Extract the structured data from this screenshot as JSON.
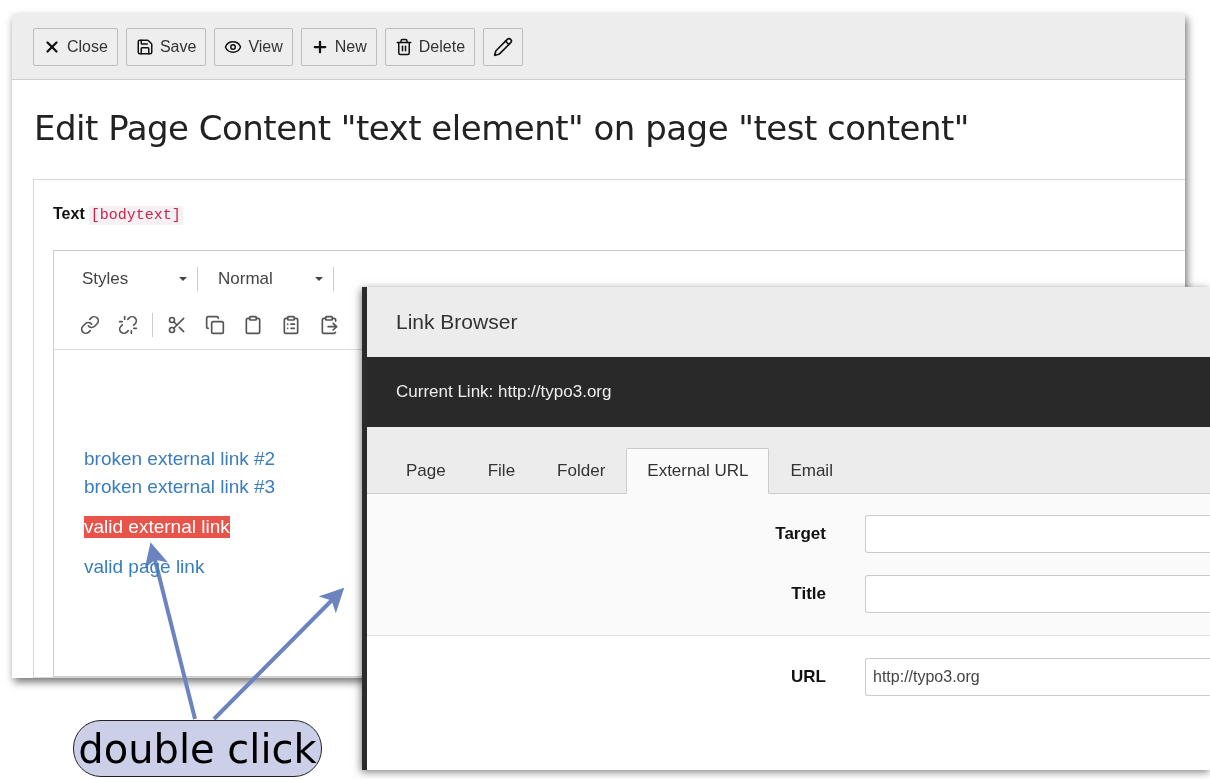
{
  "editor_window": {
    "toolbar": [
      {
        "kind": "close",
        "label": "Close"
      },
      {
        "kind": "save",
        "label": "Save"
      },
      {
        "kind": "view",
        "label": "View"
      },
      {
        "kind": "new",
        "label": "New"
      },
      {
        "kind": "delete",
        "label": "Delete"
      },
      {
        "kind": "edit"
      }
    ],
    "heading": "Edit Page Content \"text element\" on page \"test content\"",
    "field": {
      "label": "Text",
      "name": "[bodytext]"
    },
    "rte": {
      "selects": [
        {
          "label": "Styles"
        },
        {
          "label": "Normal"
        }
      ],
      "buttons": [
        {
          "kind": "link"
        },
        {
          "kind": "unlink"
        },
        {
          "kind": "cut"
        },
        {
          "kind": "copy"
        },
        {
          "kind": "paste"
        },
        {
          "kind": "paste-text"
        },
        {
          "kind": "paste-word"
        }
      ],
      "paragraphs": [
        {
          "links": [
            {
              "text": "broken external link #2",
              "selected": false
            },
            {
              "text": "broken external link #3",
              "selected": false
            }
          ]
        },
        {
          "links": [
            {
              "text": "valid external link",
              "selected": true
            }
          ]
        },
        {
          "links": [
            {
              "text": "valid page link",
              "selected": false
            }
          ]
        }
      ]
    }
  },
  "link_browser": {
    "title": "Link Browser",
    "current_link": "Current Link: http://typo3.org",
    "tabs": [
      {
        "label": "Page",
        "selected": false
      },
      {
        "label": "File",
        "selected": false
      },
      {
        "label": "Folder",
        "selected": false
      },
      {
        "label": "External URL",
        "selected": true
      },
      {
        "label": "Email",
        "selected": false
      }
    ],
    "option_fields": [
      {
        "label": "Target"
      },
      {
        "label": "Title"
      }
    ],
    "url_field": {
      "label": "URL",
      "value": "http://typo3.org"
    }
  },
  "annotation": {
    "text": "double click"
  }
}
